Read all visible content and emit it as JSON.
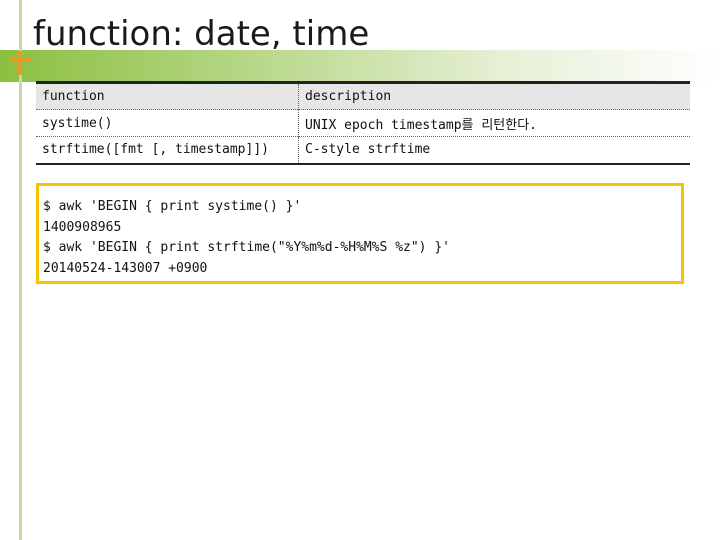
{
  "slide": {
    "title": "function: date, time"
  },
  "table": {
    "headers": [
      "function",
      "description"
    ],
    "rows": [
      [
        "systime()",
        "UNIX epoch timestamp를 리턴한다."
      ],
      [
        "strftime([fmt [, timestamp]])",
        "C-style strftime"
      ]
    ]
  },
  "code": {
    "lines": [
      "$ awk 'BEGIN { print systime() }'",
      "1400908965",
      "$ awk 'BEGIN { print strftime(\"%Y%m%d-%H%M%S %z\") }'",
      "20140524-143007 +0900"
    ]
  },
  "colors": {
    "accent_orange": "#e89a26",
    "title_bar_green": "#8cbf3f",
    "code_border_yellow": "#f5c400"
  }
}
